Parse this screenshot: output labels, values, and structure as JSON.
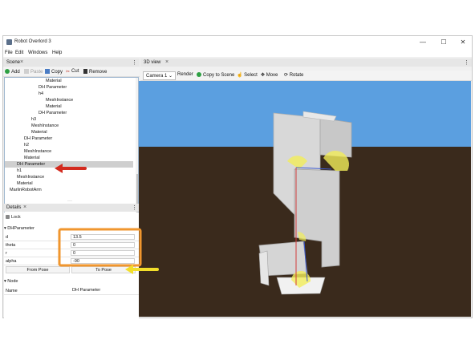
{
  "window": {
    "title": "Robot Overlord 3",
    "menu": [
      "File",
      "Edit",
      "Windows",
      "Help"
    ],
    "controls": {
      "minimize": "—",
      "maximize": "☐",
      "close": "✕"
    }
  },
  "scene_panel": {
    "tab_label": "Scene",
    "toolbar": {
      "add": "Add",
      "paste": "Paste",
      "copy": "Copy",
      "cut": "Cut",
      "remove": "Remove"
    },
    "tree": [
      {
        "label": "Material",
        "indent": 5
      },
      {
        "label": "DH Parameter",
        "indent": 4
      },
      {
        "label": "h4",
        "indent": 4
      },
      {
        "label": "MeshInstance",
        "indent": 5
      },
      {
        "label": "Material",
        "indent": 5
      },
      {
        "label": "DH Parameter",
        "indent": 4
      },
      {
        "label": "h3",
        "indent": 3
      },
      {
        "label": "MeshInstance",
        "indent": 3
      },
      {
        "label": "Material",
        "indent": 3
      },
      {
        "label": "DH Parameter",
        "indent": 2
      },
      {
        "label": "h2",
        "indent": 2
      },
      {
        "label": "MeshInstance",
        "indent": 2
      },
      {
        "label": "Material",
        "indent": 2
      },
      {
        "label": "DH Parameter",
        "indent": 1,
        "selected": true
      },
      {
        "label": "h1",
        "indent": 1
      },
      {
        "label": "MeshInstance",
        "indent": 1
      },
      {
        "label": "Material",
        "indent": 1
      },
      {
        "label": "MarlinRobotArm",
        "indent": 0
      }
    ]
  },
  "details_panel": {
    "tab_label": "Details",
    "lock_label": "Lock",
    "dh_section": "DHParameter",
    "fields": [
      {
        "name": "d",
        "value": "13.5"
      },
      {
        "name": "theta",
        "value": "0"
      },
      {
        "name": "r",
        "value": "0"
      },
      {
        "name": "alpha",
        "value": "-90"
      }
    ],
    "from_pose": "From Pose",
    "to_pose": "To Pose",
    "node_section": "Node",
    "node_name_label": "Name",
    "node_name_value": "DH Parameter"
  },
  "view3d": {
    "tab_label": "3D view",
    "camera_select": "Camera 1",
    "render": "Render",
    "copy_to_scene": "Copy to Scene",
    "select": "Select",
    "move": "Move",
    "rotate": "Rotate",
    "colors": {
      "sky": "#5b9fe0",
      "ground": "#3a2a1c"
    }
  },
  "annotations": {
    "arrow_red": "#d32a1e",
    "highlight_orange": "#f0962e",
    "arrow_yellow": "#f2de2a"
  }
}
